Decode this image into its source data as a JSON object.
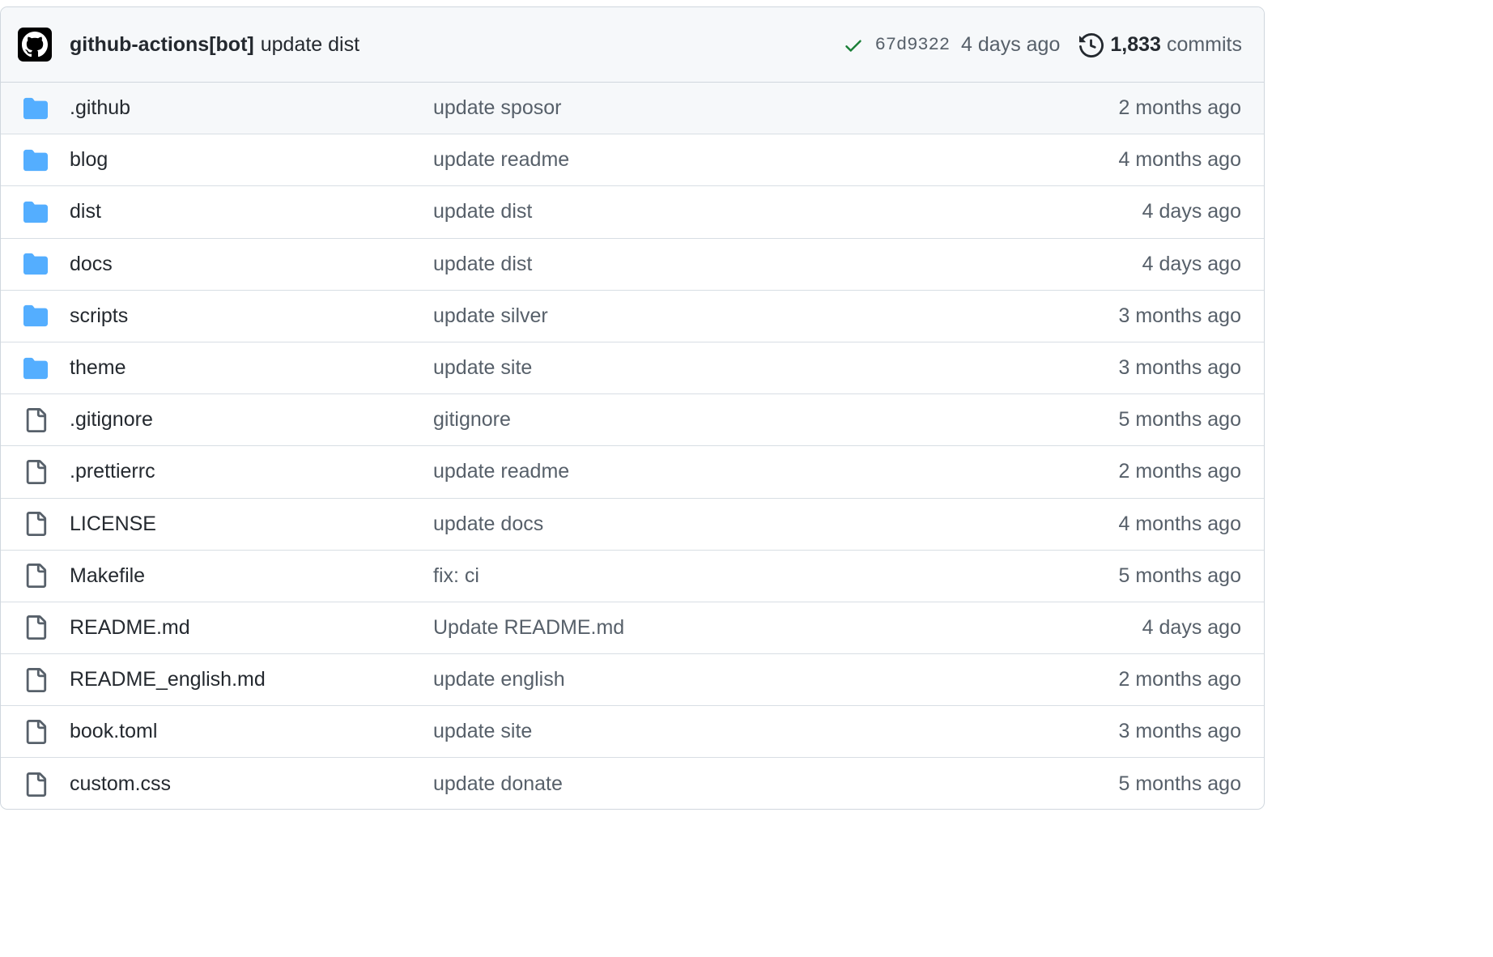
{
  "commit": {
    "author": "github-actions[bot]",
    "message": "update dist",
    "sha": "67d9322",
    "age": "4 days ago",
    "commits_count": "1,833",
    "commits_label": "commits"
  },
  "icons": {
    "avatar": "github-mark-icon",
    "status": "check-icon",
    "history": "history-icon",
    "folder": "folder-icon",
    "file": "file-icon"
  },
  "colors": {
    "folder": "#54aeff",
    "check": "#1a7f37",
    "muted": "#57606a",
    "text": "#24292f",
    "border": "#d0d7de"
  },
  "files": [
    {
      "type": "folder",
      "name": ".github",
      "message": "update sposor",
      "age": "2 months ago"
    },
    {
      "type": "folder",
      "name": "blog",
      "message": "update readme",
      "age": "4 months ago"
    },
    {
      "type": "folder",
      "name": "dist",
      "message": "update dist",
      "age": "4 days ago"
    },
    {
      "type": "folder",
      "name": "docs",
      "message": "update dist",
      "age": "4 days ago"
    },
    {
      "type": "folder",
      "name": "scripts",
      "message": "update silver",
      "age": "3 months ago"
    },
    {
      "type": "folder",
      "name": "theme",
      "message": "update site",
      "age": "3 months ago"
    },
    {
      "type": "file",
      "name": ".gitignore",
      "message": "gitignore",
      "age": "5 months ago"
    },
    {
      "type": "file",
      "name": ".prettierrc",
      "message": "update readme",
      "age": "2 months ago"
    },
    {
      "type": "file",
      "name": "LICENSE",
      "message": "update docs",
      "age": "4 months ago"
    },
    {
      "type": "file",
      "name": "Makefile",
      "message": "fix: ci",
      "age": "5 months ago"
    },
    {
      "type": "file",
      "name": "README.md",
      "message": "Update README.md",
      "age": "4 days ago"
    },
    {
      "type": "file",
      "name": "README_english.md",
      "message": "update english",
      "age": "2 months ago"
    },
    {
      "type": "file",
      "name": "book.toml",
      "message": "update site",
      "age": "3 months ago"
    },
    {
      "type": "file",
      "name": "custom.css",
      "message": "update donate",
      "age": "5 months ago"
    }
  ]
}
